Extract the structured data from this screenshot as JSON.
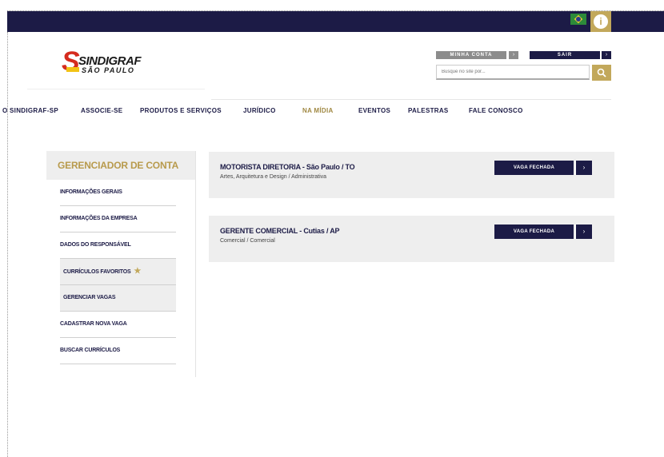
{
  "header": {
    "account_label": "MINHA CONTA",
    "account_arrow": "›",
    "exit_label": "SAIR",
    "exit_arrow": "›",
    "search_placeholder": "Busque no site por...",
    "search_icon": "search-icon",
    "globe_glyph": "i"
  },
  "logo": {
    "name": "SINDIGRAF",
    "sub": "SÃO PAULO",
    "mark": "S"
  },
  "nav": {
    "items": [
      {
        "label": "O SINDIGRAF-SP"
      },
      {
        "label": "ASSOCIE-SE"
      },
      {
        "label": "PRODUTOS E SERVIÇOS"
      },
      {
        "label": "JURÍDICO"
      },
      {
        "label": "NA MÍDIA"
      },
      {
        "label": "EVENTOS"
      },
      {
        "label": "PALESTRAS"
      },
      {
        "label": "FALE CONOSCO"
      }
    ]
  },
  "sidebar": {
    "title": "GERENCIADOR DE CONTA",
    "items": [
      {
        "label": "INFORMAÇÕES GERAIS"
      },
      {
        "label": "INFORMAÇÕES DA EMPRESA"
      },
      {
        "label": "DADOS DO RESPONSÁVEL"
      },
      {
        "label": "CURRÍCULOS FAVORITOS",
        "star": "★"
      },
      {
        "label": "GERENCIAR VAGAS"
      },
      {
        "label": "CADASTRAR NOVA VAGA"
      },
      {
        "label": "BUSCAR CURRÍCULOS"
      }
    ]
  },
  "jobs": [
    {
      "title": "MOTORISTA DIRETORIA - São Paulo / TO",
      "category": "Artes, Arquitetura e Design / Administrativa",
      "status": "VAGA FECHADA",
      "arrow": "›"
    },
    {
      "title": "GERENTE COMERCIAL - Cutias / AP",
      "category": "Comercial / Comercial",
      "status": "VAGA FECHADA",
      "arrow": "›"
    }
  ],
  "colors": {
    "navy": "#1c1b46",
    "gold": "#c2a85b",
    "brand_red": "#d52b1e",
    "brand_yellow": "#f2c315"
  }
}
